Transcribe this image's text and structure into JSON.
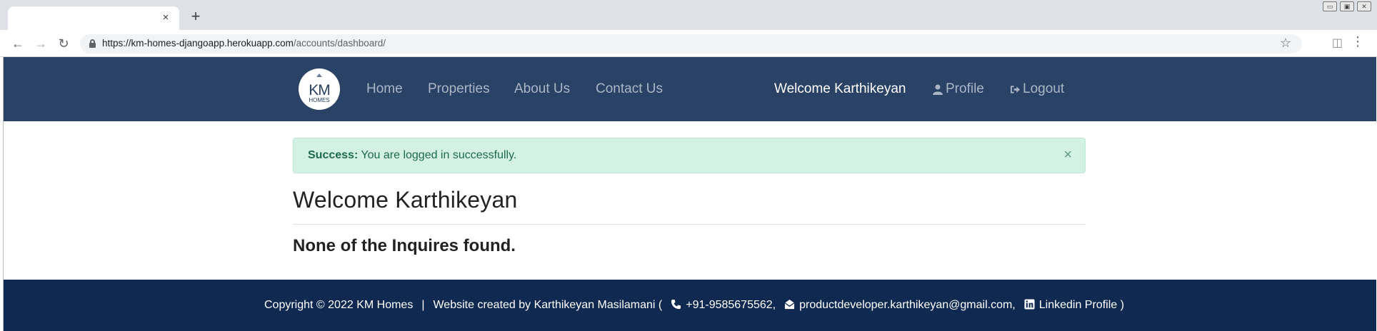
{
  "browser": {
    "tab_title": "",
    "tab_close": "×",
    "new_tab": "+",
    "window_controls": [
      "▭",
      "▣",
      "✕"
    ],
    "url_host": "https://km-homes-djangoapp.herokuapp.com",
    "url_path": "/accounts/dashboard/",
    "back": "←",
    "forward": "→",
    "reload": "↻",
    "star": "☆",
    "camera": "◫",
    "menu": "⋮"
  },
  "navbar": {
    "logo_km": "KM",
    "logo_homes": "HOMES",
    "links": [
      "Home",
      "Properties",
      "About Us",
      "Contact Us"
    ],
    "welcome": "Welcome Karthikeyan",
    "profile": "Profile",
    "logout": "Logout"
  },
  "alert": {
    "label": "Success:",
    "message": "You are logged in successfully.",
    "close": "×"
  },
  "main": {
    "welcome_heading": "Welcome Karthikeyan",
    "inquiries_text": "None of the Inquires found."
  },
  "footer": {
    "copyright": "Copyright © 2022 KM Homes",
    "separator": "|",
    "created_by": "Website created by Karthikeyan Masilamani (",
    "phone": "+91-9585675562,",
    "email": "productdeveloper.karthikeyan@gmail.com,",
    "linkedin": "Linkedin Profile )"
  },
  "colors": {
    "navbar_bg": "#2a4265",
    "footer_bg": "#0f2950",
    "alert_bg": "#d4f1e6",
    "alert_text": "#1e6b4a"
  }
}
